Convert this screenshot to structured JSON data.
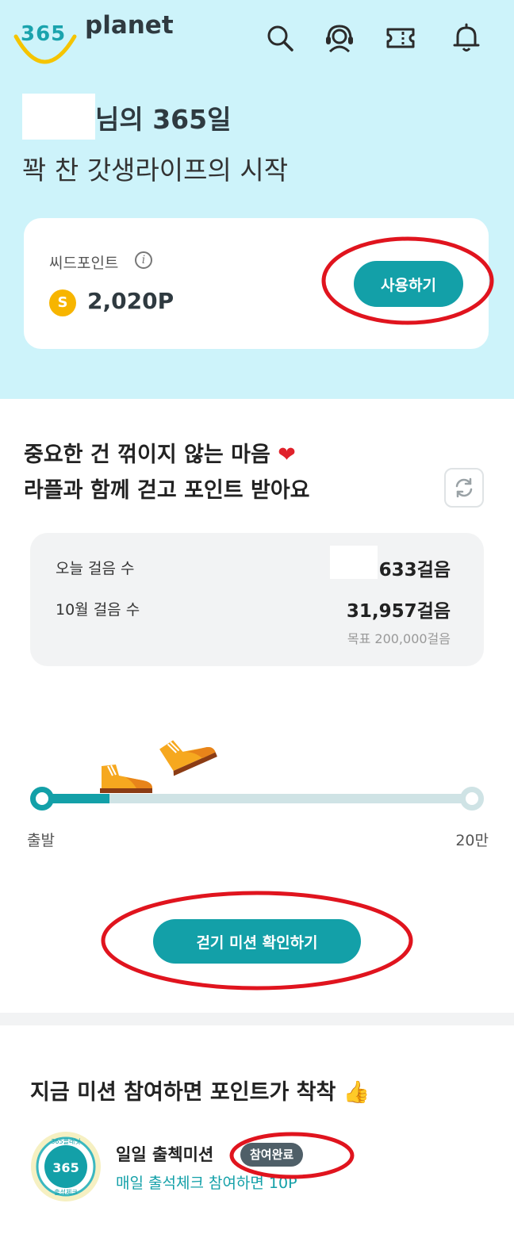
{
  "header": {
    "logo_number": "365",
    "logo_word": "planet",
    "icons": [
      "search-icon",
      "support-headset-icon",
      "ticket-icon",
      "bell-icon"
    ]
  },
  "greeting": {
    "title": "님의 365일",
    "subtitle": "꽉 찬 갓생라이프의 시작"
  },
  "points": {
    "label": "씨드포인트",
    "info_glyph": "i",
    "coin_glyph": "S",
    "value": "2,020P",
    "use_button": "사용하기"
  },
  "walking": {
    "title_line1": "중요한 건 꺾이지 않는 마음",
    "heart": "❤",
    "title_line2": "라플과 함께 걷고 포인트 받아요",
    "today_label": "오늘 걸음 수",
    "today_value": "633걸음",
    "month_label": "10월 걸음 수",
    "month_value": "31,957걸음",
    "goal": "목표 200,000걸음",
    "progress_fraction": 0.16,
    "progress_start": "출발",
    "progress_end": "20만",
    "mission_button": "걷기 미션 확인하기"
  },
  "missions": {
    "title": "지금 미션 참여하면 포인트가 착착",
    "title_emoji": "👍",
    "items": [
      {
        "title": "일일 출첵미션",
        "status": "참여완료",
        "subtitle": "매일 출석체크 참여하면 10P",
        "badge_number": "365",
        "badge_top": "365플래닛",
        "badge_bottom": "출석체크"
      }
    ]
  },
  "colors": {
    "top_background": "#cdf3fa",
    "accent": "#13a0a8",
    "logo_arc": "#f5c400",
    "annotation": "#e0141e",
    "chip": "#4f5f68"
  }
}
